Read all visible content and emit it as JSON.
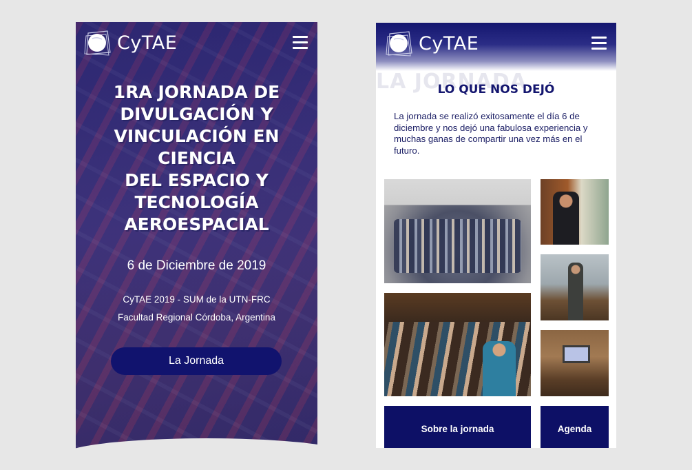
{
  "left": {
    "logo_text": "CyTAE",
    "title_lines": [
      "1ra Jornada de",
      "Divulgación y",
      "Vinculación en Ciencia",
      "del Espacio y",
      "Tecnología",
      "Aeroespacial"
    ],
    "date": "6 de Diciembre de 2019",
    "venue": "CyTAE 2019 - SUM de la UTN-FRC",
    "place": "Facultad Regional Córdoba, Argentina",
    "button_label": "La Jornada"
  },
  "right": {
    "logo_text": "CyTAE",
    "background_word": "LA JORNADA",
    "section_title": "LO QUE NOS DEJÓ",
    "section_text": "La jornada se realizó exitosamente el día 6 de diciembre y nos dejó una fabulosa experiencia y muchas ganas de compartir una vez más en el futuro.",
    "btn_sobre": "Sobre la jornada",
    "btn_agenda": "Agenda"
  },
  "icons": {
    "logo": "globe-logo-icon",
    "menu": "hamburger-menu-icon"
  },
  "colors": {
    "brand_navy": "#11136e",
    "page_background": "#e7e7e7"
  }
}
